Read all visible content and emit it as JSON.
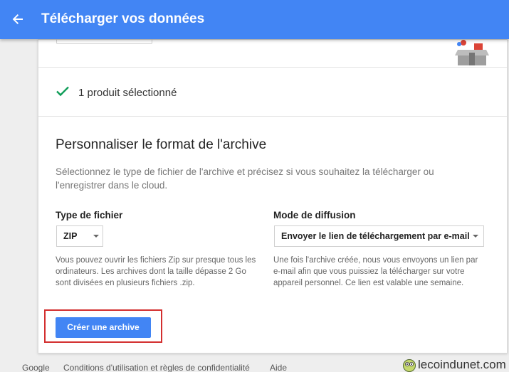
{
  "header": {
    "title": "Télécharger vos données"
  },
  "selection": {
    "text": "1 produit sélectionné"
  },
  "format": {
    "title": "Personnaliser le format de l'archive",
    "description": "Sélectionnez le type de fichier de l'archive et précisez si vous souhaitez la télécharger ou l'enregistrer dans le cloud."
  },
  "file_type": {
    "label": "Type de fichier",
    "selected": "ZIP",
    "help": "Vous pouvez ouvrir les fichiers Zip sur presque tous les ordinateurs. Les archives dont la taille dépasse 2 Go sont divisées en plusieurs fichiers .zip."
  },
  "delivery": {
    "label": "Mode de diffusion",
    "selected": "Envoyer le lien de téléchargement par e-mail",
    "help": "Une fois l'archive créée, nous vous envoyons un lien par e-mail afin que vous puissiez la télécharger sur votre appareil personnel. Ce lien est valable une semaine."
  },
  "actions": {
    "create_label": "Créer une archive"
  },
  "footer": {
    "google": "Google",
    "terms": "Conditions d'utilisation et règles de confidentialité",
    "help": "Aide"
  },
  "watermark": {
    "text": "lecoindunet.com"
  },
  "colors": {
    "accent": "#4285f4",
    "check": "#0f9d58",
    "highlight": "#d32f2f"
  }
}
